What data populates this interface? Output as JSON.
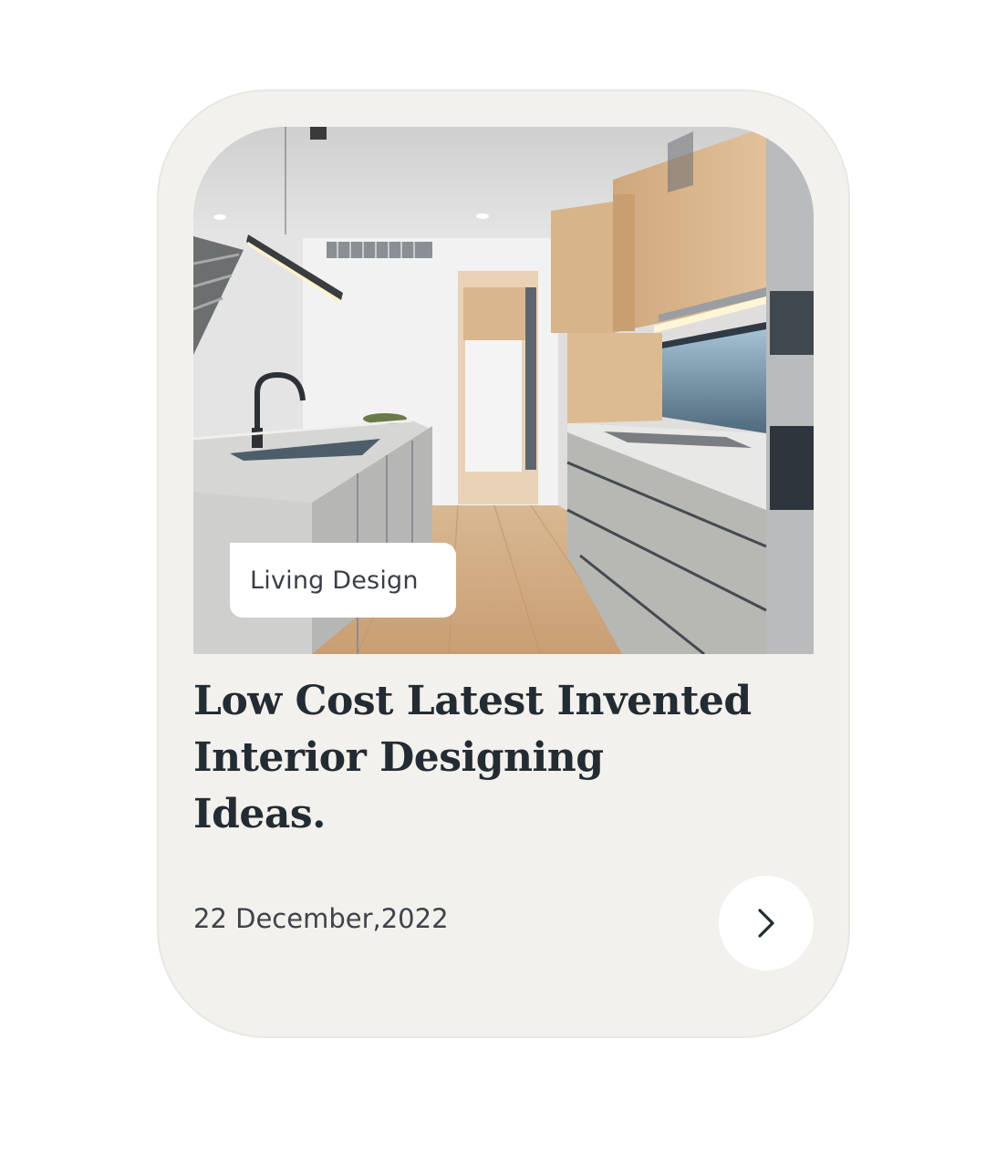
{
  "post": {
    "category": "Living Design",
    "title_lines": [
      "Low Cost Latest Invented",
      "Interior Designing",
      "Ideas."
    ],
    "date": "22 December,2022",
    "image_icon": "kitchen-photo",
    "next_icon": "chevron-right-icon"
  },
  "colors": {
    "card_background": "#f3f1ed",
    "title_text": "#232b33",
    "date_text": "#3f4349",
    "tag_background": "#ffffff",
    "button_background": "#ffffff"
  }
}
